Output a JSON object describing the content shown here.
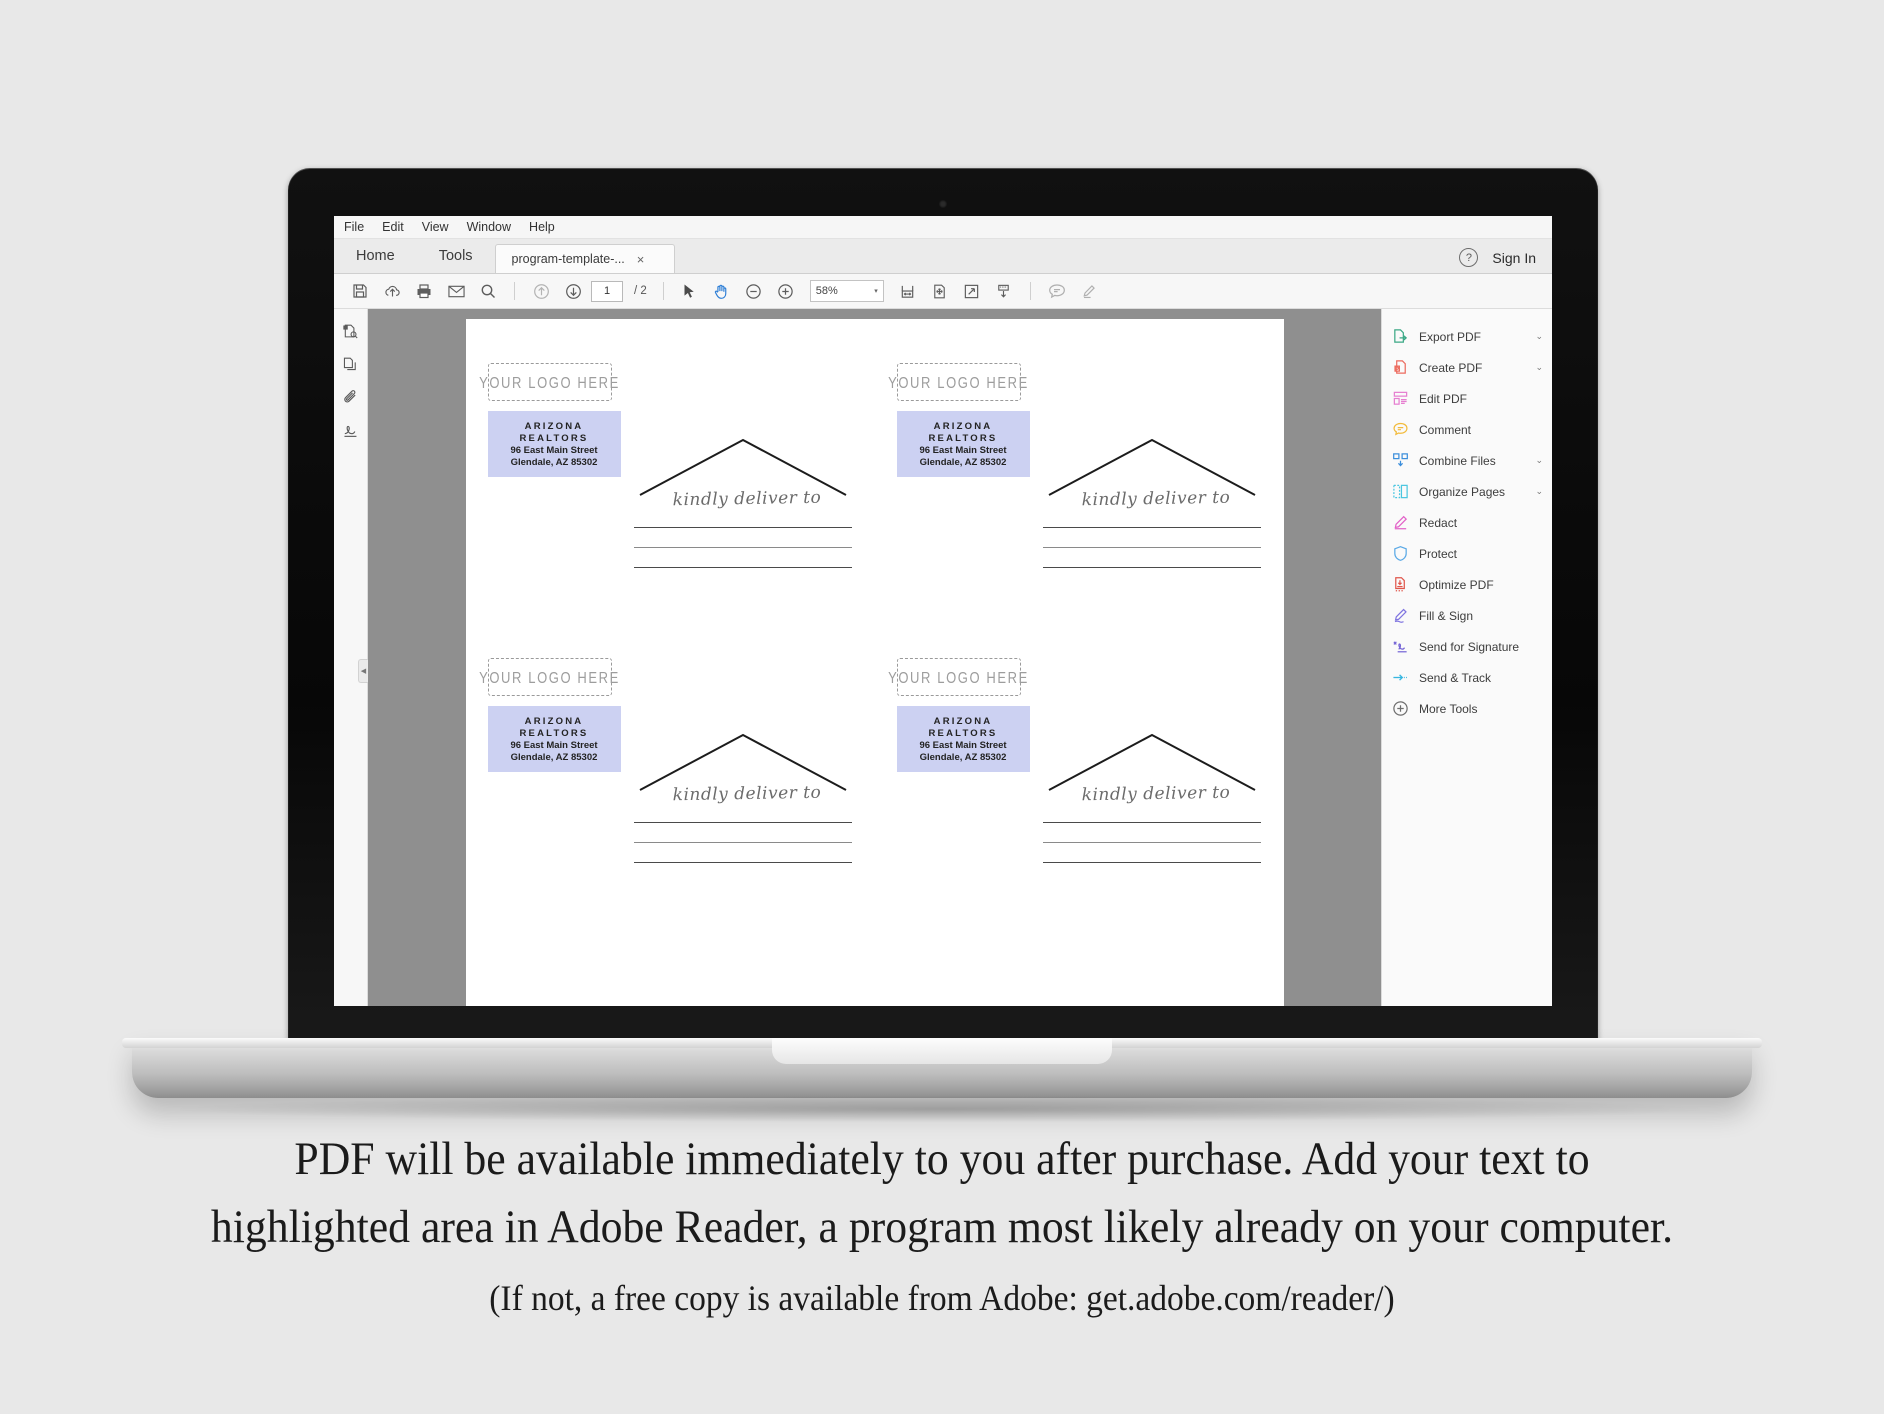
{
  "app": {
    "menubar": [
      "File",
      "Edit",
      "View",
      "Window",
      "Help"
    ],
    "tabs": {
      "home": "Home",
      "tools": "Tools",
      "document": "program-template-...",
      "close": "×"
    },
    "help_icon_label": "?",
    "sign_in": "Sign In",
    "toolbar": {
      "page_current": "1",
      "page_total": "/ 2",
      "zoom_value": "58%",
      "zoom_caret": "▾",
      "icons": [
        "save-icon",
        "upload-to-cloud-icon",
        "print-icon",
        "email-icon",
        "search-icon",
        "previous-page-icon",
        "next-page-icon",
        "select-cursor-icon",
        "hand-tool-icon",
        "zoom-out-icon",
        "zoom-in-icon",
        "fit-width-icon",
        "fit-page-icon",
        "fullscreen-icon",
        "read-mode-icon",
        "comment-icon",
        "highlight-icon"
      ]
    },
    "left_rail_icons": [
      "page-thumbnails-search-icon",
      "page-thumbnails-icon",
      "attachments-icon",
      "signatures-icon"
    ],
    "left_rail_handle": "◀",
    "right_panel": {
      "tools": [
        {
          "label": "Export PDF",
          "icon": "export-pdf-icon",
          "color": "#3aa885",
          "chevron": "⌄"
        },
        {
          "label": "Create PDF",
          "icon": "create-pdf-icon",
          "color": "#ec6b5e",
          "chevron": "⌄"
        },
        {
          "label": "Edit PDF",
          "icon": "edit-pdf-icon",
          "color": "#e67ed0",
          "chevron": ""
        },
        {
          "label": "Comment",
          "icon": "comment-icon",
          "color": "#f2bb3c",
          "chevron": ""
        },
        {
          "label": "Combine Files",
          "icon": "combine-files-icon",
          "color": "#3b8edb",
          "chevron": "⌄"
        },
        {
          "label": "Organize Pages",
          "icon": "organize-pages-icon",
          "color": "#4ac6e0",
          "chevron": "⌄"
        },
        {
          "label": "Redact",
          "icon": "redact-icon",
          "color": "#e262c8",
          "chevron": ""
        },
        {
          "label": "Protect",
          "icon": "protect-icon",
          "color": "#5aa9e6",
          "chevron": ""
        },
        {
          "label": "Optimize PDF",
          "icon": "optimize-pdf-icon",
          "color": "#e0564b",
          "chevron": ""
        },
        {
          "label": "Fill & Sign",
          "icon": "fill-and-sign-icon",
          "color": "#7f74e0",
          "chevron": ""
        },
        {
          "label": "Send for Signature",
          "icon": "send-for-signature-icon",
          "color": "#7565d6",
          "chevron": ""
        },
        {
          "label": "Send & Track",
          "icon": "send-and-track-icon",
          "color": "#37b6e0",
          "chevron": ""
        },
        {
          "label": "More Tools",
          "icon": "more-tools-icon",
          "color": "#6e6e6e",
          "chevron": ""
        }
      ]
    }
  },
  "document": {
    "highlight_color": "#ccd1f2",
    "labels": [
      {
        "logo_placeholder": "YOUR LOGO HERE",
        "return_address": {
          "line1": "ARIZONA",
          "line2": "REALTORS",
          "line3": "96 East Main Street",
          "line4": "Glendale, AZ 85302"
        },
        "deliver_text": "kindly deliver to"
      },
      {
        "logo_placeholder": "YOUR LOGO HERE",
        "return_address": {
          "line1": "ARIZONA",
          "line2": "REALTORS",
          "line3": "96 East Main Street",
          "line4": "Glendale, AZ 85302"
        },
        "deliver_text": "kindly deliver to"
      },
      {
        "logo_placeholder": "YOUR LOGO HERE",
        "return_address": {
          "line1": "ARIZONA",
          "line2": "REALTORS",
          "line3": "96 East Main Street",
          "line4": "Glendale, AZ 85302"
        },
        "deliver_text": "kindly deliver to"
      },
      {
        "logo_placeholder": "YOUR LOGO HERE",
        "return_address": {
          "line1": "ARIZONA",
          "line2": "REALTORS",
          "line3": "96 East Main Street",
          "line4": "Glendale, AZ 85302"
        },
        "deliver_text": "kindly deliver to"
      }
    ]
  },
  "caption": {
    "line1": "PDF will be available immediately to you after purchase.  Add your text to",
    "line2": "highlighted area in Adobe Reader, a program most likely already on your computer.",
    "line3": "(If not, a free copy is available from Adobe: get.adobe.com/reader/)"
  }
}
